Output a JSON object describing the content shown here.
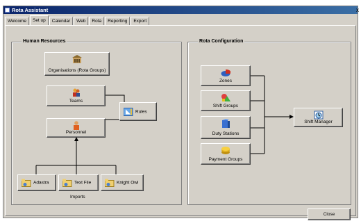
{
  "window": {
    "title": "Rota Assistant",
    "close_glyph": "x"
  },
  "tabs": [
    {
      "label": "Welcome"
    },
    {
      "label": "Set up"
    },
    {
      "label": "Calendar"
    },
    {
      "label": "Web"
    },
    {
      "label": "Rota"
    },
    {
      "label": "Reporting"
    },
    {
      "label": "Export"
    }
  ],
  "active_tab": "Set up",
  "human_resources": {
    "title": "Human Resources",
    "organisations": "Organisations (Rota Groups)",
    "teams": "Teams",
    "rules": "Rules",
    "personnel": "Personnel",
    "imports_label": "Imports",
    "imports": [
      {
        "label": "Adastra",
        "icon": "import-folder-icon"
      },
      {
        "label": "Text File",
        "icon": "import-folder-icon"
      },
      {
        "label": "Knight Owl",
        "icon": "import-folder-icon"
      }
    ]
  },
  "rota_configuration": {
    "title": "Rota Configuration",
    "items": [
      {
        "label": "Zones",
        "icon": "zones-icon"
      },
      {
        "label": "Shift Groups",
        "icon": "shift-groups-icon"
      },
      {
        "label": "Duty Stations",
        "icon": "duty-stations-icon"
      },
      {
        "label": "Payment Groups",
        "icon": "payment-groups-icon"
      }
    ],
    "shift_manager": "Shift Manager"
  },
  "footer": {
    "close_label": "Close"
  },
  "colors": {
    "titlebar": "#0a246a",
    "face": "#d4d0c8"
  }
}
